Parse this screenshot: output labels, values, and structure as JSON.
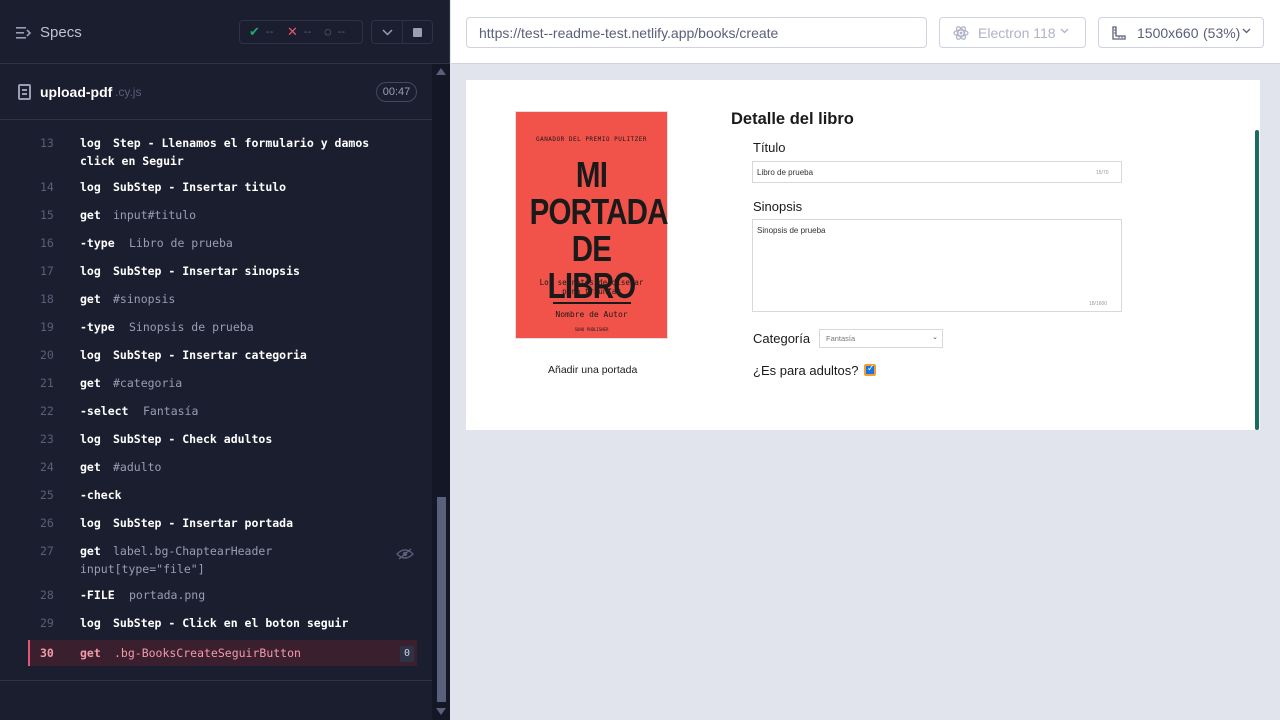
{
  "reporter": {
    "specs_label": "Specs",
    "stats": {
      "passed": "--",
      "failed": "--",
      "pending": "--"
    }
  },
  "spec": {
    "file_name": "upload-pdf",
    "file_ext": ".cy.js",
    "duration": "00:47"
  },
  "commands": [
    {
      "num": "13",
      "name": "log",
      "message": "Step - Llenamos el formulario y damos",
      "message2": "click en Seguir",
      "bold": true
    },
    {
      "num": "14",
      "name": "log",
      "message": "SubStep - Insertar titulo",
      "bold": true
    },
    {
      "num": "15",
      "name": "get",
      "message": "input#titulo",
      "bold": false
    },
    {
      "num": "16",
      "name": "-type",
      "message": "Libro de prueba",
      "bold": false
    },
    {
      "num": "17",
      "name": "log",
      "message": "SubStep - Insertar sinopsis",
      "bold": true
    },
    {
      "num": "18",
      "name": "get",
      "message": "#sinopsis",
      "bold": false
    },
    {
      "num": "19",
      "name": "-type",
      "message": "Sinopsis de prueba",
      "bold": false
    },
    {
      "num": "20",
      "name": "log",
      "message": "SubStep - Insertar categoria",
      "bold": true
    },
    {
      "num": "21",
      "name": "get",
      "message": "#categoria",
      "bold": false
    },
    {
      "num": "22",
      "name": "-select",
      "message": "Fantasía",
      "bold": false
    },
    {
      "num": "23",
      "name": "log",
      "message": "SubStep - Check adultos",
      "bold": true
    },
    {
      "num": "24",
      "name": "get",
      "message": "#adulto",
      "bold": false
    },
    {
      "num": "25",
      "name": "-check",
      "message": "",
      "bold": false
    },
    {
      "num": "26",
      "name": "log",
      "message": "SubStep - Insertar portada",
      "bold": true
    },
    {
      "num": "27",
      "name": "get",
      "message": "label.bg-ChaptearHeader",
      "message2": "input[type=\"file\"]",
      "bold": false
    },
    {
      "num": "28",
      "name": "-FILE",
      "message": "portada.png",
      "bold": false
    },
    {
      "num": "29",
      "name": "log",
      "message": "SubStep - Click en el boton seguir",
      "bold": true
    },
    {
      "num": "30",
      "name": "get",
      "message": ".bg-BooksCreateSeguirButton",
      "bold": false,
      "badge": "0"
    }
  ],
  "browser_bar": {
    "url": "https://test--readme-test.netlify.app/books/create",
    "browser": "Electron 118",
    "viewport": "1500x660",
    "zoom": "(53%)"
  },
  "app": {
    "cover": {
      "top_text": "GANADOR DEL PREMIO PULITZER",
      "title": "MI PORTADA DE LIBRO",
      "subtitle": "Los secretos de diseñar para triunfar",
      "author": "Nombre de Autor",
      "publisher": "SOHO PUBLISHER"
    },
    "add_cover": "Añadir una portada",
    "section_title": "Detalle del libro",
    "title_label": "Título",
    "title_value": "Libro de prueba",
    "title_counter": "15/70",
    "synopsis_label": "Sinopsis",
    "synopsis_value": "Sinopsis de prueba",
    "synopsis_counter": "18/1600",
    "category_label": "Categoría",
    "category_value": "Fantasía",
    "adult_label": "¿Es para adultos?"
  },
  "colors": {
    "accent": "#1a6b63",
    "error": "#e45770",
    "passed": "#1fa971",
    "cover": "#f1534a"
  }
}
